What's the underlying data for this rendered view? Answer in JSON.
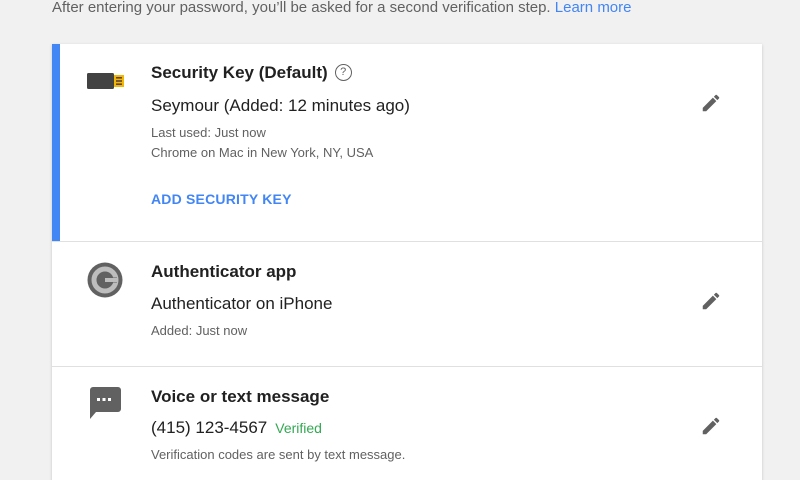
{
  "intro": {
    "text": "After entering your password, you’ll be asked for a second verification step.",
    "learn_more": "Learn more"
  },
  "methods": [
    {
      "title": "Security Key (Default)",
      "help_glyph": "?",
      "primary": "Seymour (Added: 12 minutes ago)",
      "secondary_1": "Last used: Just now",
      "secondary_2": "Chrome on Mac in New York, NY, USA",
      "action": "ADD SECURITY KEY",
      "icon": "usb-security-key-icon"
    },
    {
      "title": "Authenticator app",
      "primary": "Authenticator on iPhone",
      "secondary_1": "Added: Just now",
      "icon": "authenticator-app-icon"
    },
    {
      "title": "Voice or text message",
      "primary": "(415) 123-4567",
      "status": "Verified",
      "secondary_1": "Verification codes are sent by text message.",
      "icon": "sms-message-icon"
    }
  ],
  "colors": {
    "accent": "#4285f4",
    "link": "#4285f4",
    "verified": "#34a853",
    "background": "#f1f1f1"
  }
}
